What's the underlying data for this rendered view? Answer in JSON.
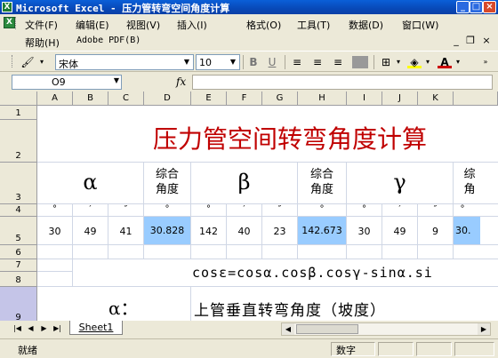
{
  "window": {
    "title": "Microsoft Excel - 压力管转弯空间角度计算",
    "app_icon": "X"
  },
  "menus": [
    {
      "label": "文件(F)"
    },
    {
      "label": "编辑(E)"
    },
    {
      "label": "视图(V)"
    },
    {
      "label": "插入(I)"
    },
    {
      "label": "格式(O)"
    },
    {
      "label": "工具(T)"
    },
    {
      "label": "数据(D)"
    },
    {
      "label": "窗口(W)"
    }
  ],
  "menus2": [
    {
      "label": "帮助(H)"
    },
    {
      "label": "Adobe PDF(B)"
    }
  ],
  "toolbar": {
    "font": "宋体",
    "size": "10",
    "bold": "B",
    "underline": "U",
    "font_color": "#CC0000",
    "fill_color": "#FFFF00"
  },
  "formula_bar": {
    "name_box": "O9",
    "fx": "fx",
    "content": ""
  },
  "columns": [
    "A",
    "B",
    "C",
    "D",
    "E",
    "F",
    "G",
    "H",
    "I",
    "J",
    "K"
  ],
  "rows": [
    "1",
    "2",
    "3",
    "4",
    "5",
    "6",
    "7",
    "8",
    "9"
  ],
  "sheet": {
    "title": "压力管空间转弯角度计算",
    "alpha": "α",
    "beta": "β",
    "gamma": "γ",
    "combined_angle": "综合角度",
    "combined_1": "综合",
    "combined_2": "角度",
    "partial_1": "综",
    "partial_2": "角",
    "unit_deg": "°",
    "unit_min": "′",
    "unit_sec": "″",
    "alpha_deg": "30",
    "alpha_min": "49",
    "alpha_sec": "41",
    "alpha_total": "30.828",
    "beta_deg": "142",
    "beta_min": "40",
    "beta_sec": "23",
    "beta_total": "142.673",
    "gamma_deg": "30",
    "gamma_min": "49",
    "gamma_sec": "9",
    "gamma_total": "30.",
    "formula": "cosε=cosα.cosβ.cosγ-sinα.si",
    "alpha_label": "α：",
    "alpha_desc": "上管垂直转弯角度（坡度）",
    "highlight_color": "#99CCFF"
  },
  "tabs": [
    {
      "label": "Sheet1"
    }
  ],
  "status": {
    "ready": "就绪",
    "mode": "数字"
  }
}
